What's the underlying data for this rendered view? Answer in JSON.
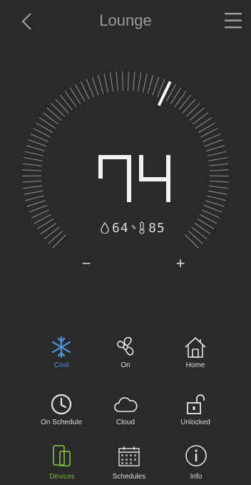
{
  "header": {
    "title": "Lounge"
  },
  "thermostat": {
    "setpoint": "74",
    "humidity": "64",
    "humidity_unit": "%",
    "indoor_temp": "85",
    "minus_label": "−",
    "plus_label": "+",
    "setpoint_fraction": 0.6
  },
  "controls": [
    {
      "id": "cool",
      "label": "Cool",
      "icon": "snowflake-icon"
    },
    {
      "id": "fan",
      "label": "On",
      "icon": "fan-icon"
    },
    {
      "id": "home",
      "label": "Home",
      "icon": "home-icon"
    },
    {
      "id": "schedule",
      "label": "On Schedule",
      "icon": "clock-icon"
    },
    {
      "id": "cloud",
      "label": "Cloud",
      "icon": "cloud-icon"
    },
    {
      "id": "lock",
      "label": "Unlocked",
      "icon": "unlock-icon"
    }
  ],
  "tabs": [
    {
      "id": "devices",
      "label": "Devices",
      "icon": "devices-icon",
      "active": true
    },
    {
      "id": "schedules",
      "label": "Schedules",
      "icon": "calendar-icon",
      "active": false
    },
    {
      "id": "info",
      "label": "Info",
      "icon": "info-icon",
      "active": false
    }
  ],
  "colors": {
    "background": "#2a2a2a",
    "cool_accent": "#4c8fd6",
    "active_tab": "#7ab33e",
    "text": "#e8e8e8"
  }
}
